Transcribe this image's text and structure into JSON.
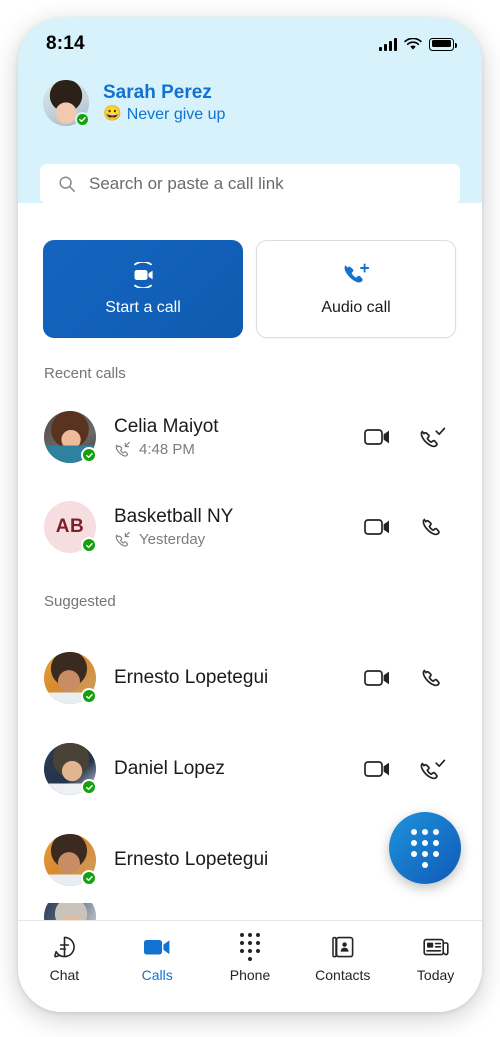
{
  "status_bar": {
    "time": "8:14",
    "signal_icon": "signal-bars-icon",
    "wifi_icon": "wifi-icon",
    "battery_icon": "battery-full-icon"
  },
  "profile": {
    "name": "Sarah Perez",
    "status_emoji": "😀",
    "status_text": "Never give up",
    "presence": "available",
    "avatar_name": "sarah-perez-avatar"
  },
  "search": {
    "placeholder": "Search or paste a call link",
    "icon": "search-icon"
  },
  "actions": {
    "primary": {
      "label": "Start a call",
      "icon": "meet-now-video-icon"
    },
    "secondary": {
      "label": "Audio call",
      "icon": "phone-add-icon"
    }
  },
  "sections": [
    {
      "title": "Recent calls"
    },
    {
      "title": "Suggested"
    }
  ],
  "recent_calls": [
    {
      "name": "Celia Maiyot",
      "direction_icon": "call-incoming-icon",
      "time": "4:48 PM",
      "presence": "available",
      "avatar_name": "celia-maiyot-avatar",
      "video_icon": "video-call-icon",
      "call_icon": "call-checkmark-icon"
    },
    {
      "name": "Basketball NY",
      "direction_icon": "call-incoming-icon",
      "time": "Yesterday",
      "presence": "available",
      "initials": "AB",
      "avatar_name": "basketball-ny-avatar",
      "video_icon": "video-call-icon",
      "call_icon": "call-icon"
    }
  ],
  "suggested": [
    {
      "name": "Ernesto Lopetegui",
      "presence": "available",
      "avatar_name": "ernesto-lopetegui-avatar",
      "video_icon": "video-call-icon",
      "call_icon": "call-icon"
    },
    {
      "name": "Daniel Lopez",
      "presence": "available",
      "avatar_name": "daniel-lopez-avatar",
      "video_icon": "video-call-icon",
      "call_icon": "call-checkmark-icon"
    },
    {
      "name": "Ernesto Lopetegui",
      "presence": "available",
      "avatar_name": "ernesto-lopetegui-avatar-2",
      "video_icon": "video-call-icon",
      "call_icon": "call-icon"
    }
  ],
  "fab": {
    "icon": "dialpad-icon",
    "label": "Dialpad"
  },
  "nav": [
    {
      "label": "Chat",
      "icon": "chat-bubble-icon",
      "active": false
    },
    {
      "label": "Calls",
      "icon": "video-camera-icon",
      "active": true
    },
    {
      "label": "Phone",
      "icon": "dialpad-icon",
      "active": false
    },
    {
      "label": "Contacts",
      "icon": "contacts-book-icon",
      "active": false
    },
    {
      "label": "Today",
      "icon": "today-news-icon",
      "active": false
    }
  ],
  "colors": {
    "header_bg": "#d7f2fb",
    "accent_blue": "#1272d0",
    "primary_button": "#1465c0",
    "presence_green": "#13a10e",
    "initials_bg": "#f6dde0",
    "initials_fg": "#7c2026",
    "muted_text": "#757575"
  }
}
